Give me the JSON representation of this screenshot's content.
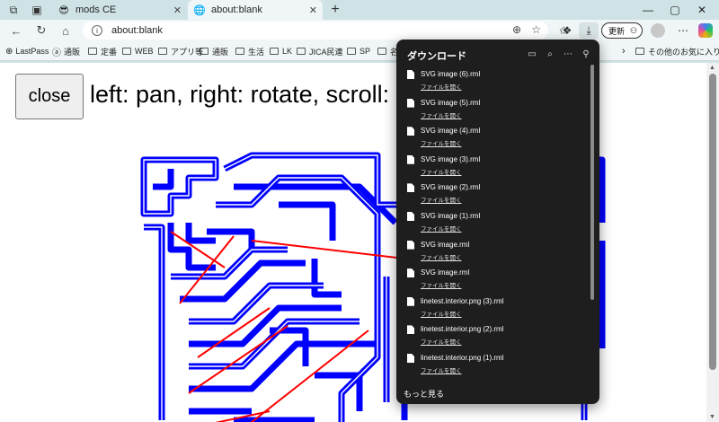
{
  "tabs": [
    {
      "title": "mods CE",
      "icon": "sunglasses-emoji-icon",
      "active": false
    },
    {
      "title": "about:blank",
      "icon": "globe-icon",
      "active": true
    }
  ],
  "address": {
    "url": "about:blank"
  },
  "toolbar": {
    "update_label": "更新"
  },
  "bookmarks": [
    {
      "label": "LastPass",
      "icon": "lastpass-icon"
    },
    {
      "label": "通販",
      "icon": "amazon-icon"
    },
    {
      "label": "定番",
      "icon": "folder-icon"
    },
    {
      "label": "WEB",
      "icon": "folder-icon"
    },
    {
      "label": "アプリ等",
      "icon": "folder-icon"
    },
    {
      "label": "通販",
      "icon": "folder-icon"
    },
    {
      "label": "生活",
      "icon": "folder-icon"
    },
    {
      "label": "LK",
      "icon": "folder-icon"
    },
    {
      "label": "JICA民連",
      "icon": "folder-icon"
    },
    {
      "label": "SP",
      "icon": "folder-icon"
    },
    {
      "label": "名",
      "icon": "folder-icon"
    }
  ],
  "bookmarks_other": "その他のお気に入り",
  "page": {
    "close_label": "close",
    "instructions": "left: pan, right: rotate, scroll: z"
  },
  "downloads": {
    "title": "ダウンロード",
    "open_label": "ファイルを開く",
    "more_label": "もっと見る",
    "items": [
      "SVG image (6).rml",
      "SVG image (5).rml",
      "SVG image (4).rml",
      "SVG image (3).rml",
      "SVG image (2).rml",
      "SVG image (1).rml",
      "SVG image.rml",
      "SVG image.rml",
      "linetest.interior.png (3).rml",
      "linetest.interior.png (2).rml",
      "linetest.interior.png (1).rml"
    ]
  },
  "colors": {
    "trace": "#0000ff",
    "path": "#ff0000",
    "panel": "#1e1e1e",
    "chrome": "#cfe3e6"
  }
}
